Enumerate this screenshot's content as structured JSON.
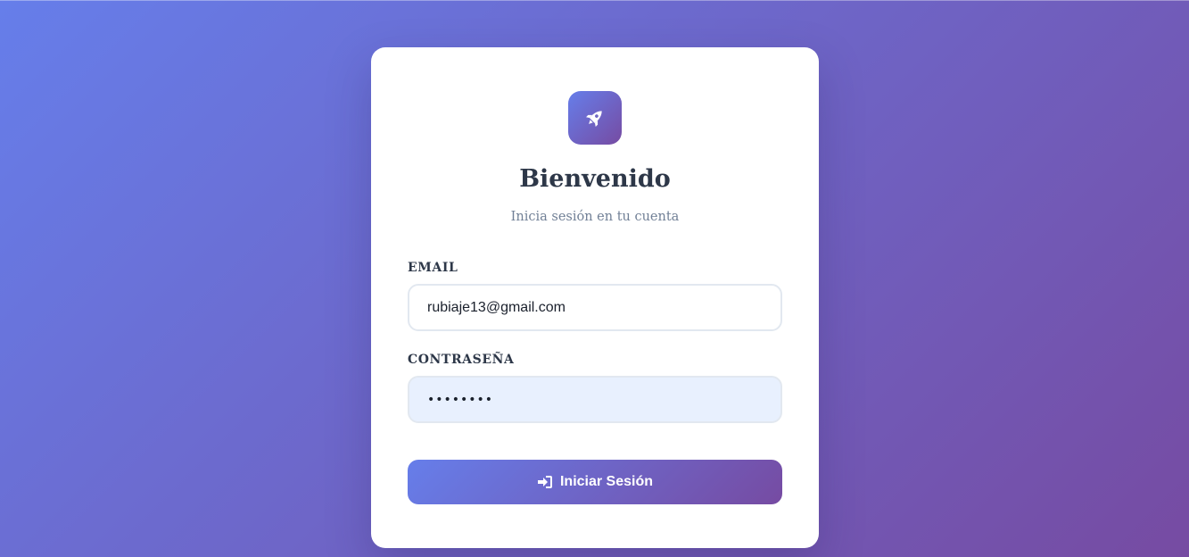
{
  "background": {
    "gradient_start": "#667eea",
    "gradient_end": "#764ba2"
  },
  "logo": {
    "icon": "rocket-icon"
  },
  "header": {
    "title": "Bienvenido",
    "subtitle": "Inicia sesión en tu cuenta"
  },
  "form": {
    "email_label": "EMAIL",
    "email_value": "rubiaje13@gmail.com",
    "password_label": "CONTRASEÑA",
    "password_value": "12345678",
    "submit_label": "Iniciar Sesión",
    "submit_icon": "sign-in-icon"
  }
}
